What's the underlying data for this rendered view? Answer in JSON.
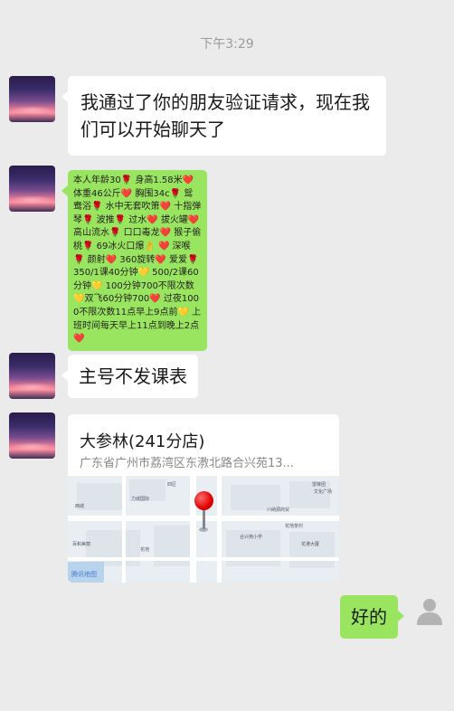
{
  "timestamp": "下午3:29",
  "messages": {
    "m1": "我通过了你的朋友验证请求，现在我们可以开始聊天了",
    "m2": "本人年龄30🌹 身高1.58米❤️ 体重46公斤❤️ 胸围34c🌹 鸳鸯浴🌹 水中无套吹箫❤️ 十指弹琴🌹 波推🌹 过水❤️ 拔火罐❤️高山流水🌹 口口毒龙❤️ 猴子偷桃🌹 69冰火口爆👌 ❤️ 深喉🌹 颜射❤️ 360旋转❤️ 爱爱🌹350/1课40分钟💛 500/2课60分钟💛 100分钟700不限次数💛双飞60分钟700❤️ 过夜1000不限次数11点早上9点前💛 上班时间每天早上11点到晚上2点❤️",
    "m3": "主号不发课表",
    "reply": "好的"
  },
  "location": {
    "name": "大参林(241分店)",
    "address": "广东省广州市荔湾区东漖北路合兴苑13...",
    "map_provider": "腾讯地图",
    "map_labels": {
      "l1": "西城",
      "l2": "力城国际",
      "l3": "四区",
      "l4": "百和美丽",
      "l5": "川纳源商贸",
      "l6": "合兴苑小学",
      "l7": "花地茶村",
      "l8": "雷锋团",
      "l9": "文化广场",
      "l10": "花港大厦",
      "l11": "花地"
    }
  },
  "icons": {
    "pin": "location-pin-icon",
    "self_avatar": "person-icon"
  }
}
